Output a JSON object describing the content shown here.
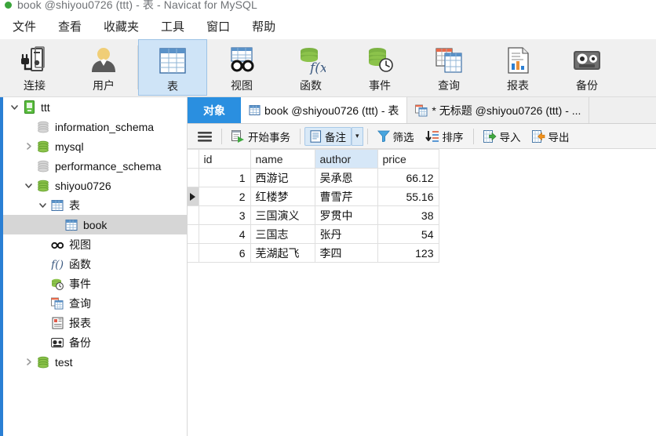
{
  "window": {
    "title": "book @shiyou0726 (ttt) - 表 - Navicat for MySQL",
    "status_dot": "green-dot-icon"
  },
  "menubar": {
    "items": [
      {
        "label": "文件",
        "name": "menu-file"
      },
      {
        "label": "查看",
        "name": "menu-view"
      },
      {
        "label": "收藏夹",
        "name": "menu-favorites"
      },
      {
        "label": "工具",
        "name": "menu-tools"
      },
      {
        "label": "窗口",
        "name": "menu-window"
      },
      {
        "label": "帮助",
        "name": "menu-help"
      }
    ]
  },
  "ribbon": {
    "items": [
      {
        "label": "连接",
        "icon": "connection-icon",
        "active": false
      },
      {
        "label": "用户",
        "icon": "user-icon",
        "active": false
      },
      {
        "label": "表",
        "icon": "table-icon",
        "active": true
      },
      {
        "label": "视图",
        "icon": "view-icon",
        "active": false
      },
      {
        "label": "函数",
        "icon": "function-icon",
        "active": false
      },
      {
        "label": "事件",
        "icon": "event-icon",
        "active": false
      },
      {
        "label": "查询",
        "icon": "query-icon",
        "active": false
      },
      {
        "label": "报表",
        "icon": "report-icon",
        "active": false
      },
      {
        "label": "备份",
        "icon": "backup-icon",
        "active": false
      }
    ]
  },
  "sidebar": {
    "nodes": [
      {
        "label": "ttt",
        "icon": "server-icon",
        "indent": 0,
        "twisty": "expanded",
        "selected": false
      },
      {
        "label": "information_schema",
        "icon": "database-grey-icon",
        "indent": 1,
        "twisty": "none",
        "selected": false
      },
      {
        "label": "mysql",
        "icon": "database-green-icon",
        "indent": 1,
        "twisty": "collapsed",
        "selected": false
      },
      {
        "label": "performance_schema",
        "icon": "database-grey-icon",
        "indent": 1,
        "twisty": "none",
        "selected": false
      },
      {
        "label": "shiyou0726",
        "icon": "database-green-icon",
        "indent": 1,
        "twisty": "expanded",
        "selected": false
      },
      {
        "label": "表",
        "icon": "table-icon",
        "indent": 2,
        "twisty": "expanded",
        "selected": false
      },
      {
        "label": "book",
        "icon": "table-icon",
        "indent": 3,
        "twisty": "none",
        "selected": true
      },
      {
        "label": "视图",
        "icon": "view-icon",
        "indent": 2,
        "twisty": "none",
        "selected": false
      },
      {
        "label": "函数",
        "icon": "function-icon",
        "indent": 2,
        "twisty": "none",
        "selected": false
      },
      {
        "label": "事件",
        "icon": "event-icon",
        "indent": 2,
        "twisty": "none",
        "selected": false
      },
      {
        "label": "查询",
        "icon": "query-icon",
        "indent": 2,
        "twisty": "none",
        "selected": false
      },
      {
        "label": "报表",
        "icon": "report-icon",
        "indent": 2,
        "twisty": "none",
        "selected": false
      },
      {
        "label": "备份",
        "icon": "backup-icon",
        "indent": 2,
        "twisty": "none",
        "selected": false
      },
      {
        "label": "test",
        "icon": "database-green-icon",
        "indent": 1,
        "twisty": "collapsed",
        "selected": false
      }
    ]
  },
  "tabs": [
    {
      "label": "对象",
      "kind": "objects",
      "icon": "none",
      "active": false
    },
    {
      "label": "book @shiyou0726 (ttt) - 表",
      "kind": "table",
      "icon": "table-icon",
      "active": true
    },
    {
      "label": "* 无标题 @shiyou0726 (ttt) - ...",
      "kind": "query",
      "icon": "query-icon",
      "active": false
    }
  ],
  "datatoolbar": {
    "hamburger": "menu-hamburger-icon",
    "buttons": [
      {
        "label": "开始事务",
        "icon": "begin-transaction-icon",
        "toggled": false,
        "caret": false
      },
      {
        "label": "备注",
        "icon": "note-icon",
        "toggled": true,
        "caret": true
      },
      {
        "label": "筛选",
        "icon": "filter-icon",
        "toggled": false,
        "caret": false
      },
      {
        "label": "排序",
        "icon": "sort-icon",
        "toggled": false,
        "caret": false
      },
      {
        "label": "导入",
        "icon": "import-icon",
        "toggled": false,
        "caret": false
      },
      {
        "label": "导出",
        "icon": "export-icon",
        "toggled": false,
        "caret": false
      }
    ]
  },
  "grid": {
    "columns": [
      {
        "label": "id",
        "selected": false,
        "align": "right",
        "width": 66
      },
      {
        "label": "name",
        "selected": false,
        "align": "left",
        "width": 82
      },
      {
        "label": "author",
        "selected": true,
        "align": "left",
        "width": 80
      },
      {
        "label": "price",
        "selected": false,
        "align": "right",
        "width": 78
      }
    ],
    "rows": [
      {
        "marked": false,
        "cells": [
          "1",
          "西游记",
          "吴承恩",
          "66.12"
        ]
      },
      {
        "marked": true,
        "cells": [
          "2",
          "红楼梦",
          "曹雪芹",
          "55.16"
        ]
      },
      {
        "marked": false,
        "cells": [
          "3",
          "三国演义",
          "罗贯中",
          "38"
        ]
      },
      {
        "marked": false,
        "cells": [
          "4",
          "三国志",
          "张丹",
          "54"
        ]
      },
      {
        "marked": false,
        "cells": [
          "6",
          "芜湖起飞",
          "李四",
          "123"
        ]
      }
    ]
  },
  "colors": {
    "accent": "#2a8fe0",
    "edge_strip": "#2a7fd4",
    "ribbon_bg": "#f0f0f0",
    "active_ribbon": "#cfe4f7",
    "selected_tree": "#d6d6d6",
    "selected_col_header": "#d6e7f7"
  }
}
